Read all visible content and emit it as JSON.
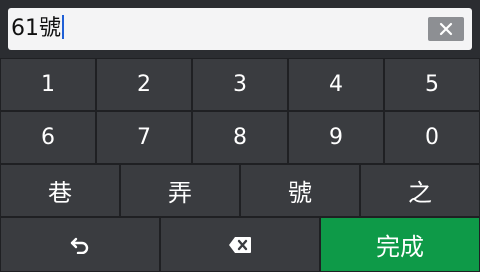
{
  "input": {
    "value": "61號",
    "clear_icon": "close-icon"
  },
  "keypad": {
    "row1": [
      "1",
      "2",
      "3",
      "4",
      "5"
    ],
    "row2": [
      "6",
      "7",
      "8",
      "9",
      "0"
    ],
    "row3": [
      "巷",
      "弄",
      "號",
      "之"
    ],
    "back_icon": "undo-arrow-icon",
    "backspace_icon": "backspace-icon",
    "done_label": "完成"
  },
  "colors": {
    "key_bg": "#3a3c40",
    "done_bg": "#0e9a48",
    "caret": "#1f5fd6"
  }
}
